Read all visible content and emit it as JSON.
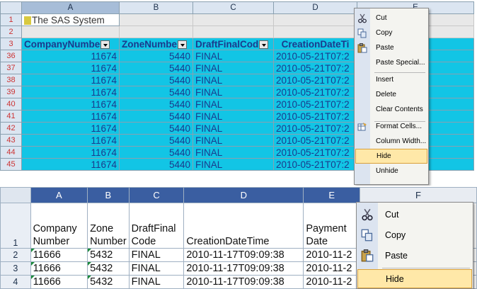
{
  "top_sheet": {
    "columns": [
      "A",
      "B",
      "C",
      "D",
      "E"
    ],
    "title_row": {
      "row": "1",
      "text": "The SAS System"
    },
    "empty_row": "2",
    "header_row": {
      "row": "3",
      "cells": [
        "CompanyNumbe",
        "ZoneNumbe",
        "DraftFinalCod",
        "CreationDateTi"
      ]
    },
    "rows": [
      {
        "row": "36",
        "company": "11674",
        "zone": "5440",
        "draft": "FINAL",
        "created": "2010-05-21T07:2"
      },
      {
        "row": "37",
        "company": "11674",
        "zone": "5440",
        "draft": "FINAL",
        "created": "2010-05-21T07:2"
      },
      {
        "row": "38",
        "company": "11674",
        "zone": "5440",
        "draft": "FINAL",
        "created": "2010-05-21T07:2"
      },
      {
        "row": "39",
        "company": "11674",
        "zone": "5440",
        "draft": "FINAL",
        "created": "2010-05-21T07:2"
      },
      {
        "row": "40",
        "company": "11674",
        "zone": "5440",
        "draft": "FINAL",
        "created": "2010-05-21T07:2"
      },
      {
        "row": "41",
        "company": "11674",
        "zone": "5440",
        "draft": "FINAL",
        "created": "2010-05-21T07:2"
      },
      {
        "row": "42",
        "company": "11674",
        "zone": "5440",
        "draft": "FINAL",
        "created": "2010-05-21T07:2"
      },
      {
        "row": "43",
        "company": "11674",
        "zone": "5440",
        "draft": "FINAL",
        "created": "2010-05-21T07:2"
      },
      {
        "row": "44",
        "company": "11674",
        "zone": "5440",
        "draft": "FINAL",
        "created": "2010-05-21T07:2"
      },
      {
        "row": "45",
        "company": "11674",
        "zone": "5440",
        "draft": "FINAL",
        "created": "2010-05-21T07:2"
      }
    ]
  },
  "top_menu": {
    "items": [
      {
        "label": "Cut",
        "icon": "scissors-icon"
      },
      {
        "label": "Copy",
        "icon": "copy-icon"
      },
      {
        "label": "Paste",
        "icon": "paste-icon"
      },
      {
        "label": "Paste Special...",
        "icon": ""
      },
      {
        "label": "Insert",
        "icon": ""
      },
      {
        "label": "Delete",
        "icon": ""
      },
      {
        "label": "Clear Contents",
        "icon": ""
      },
      {
        "label": "Format Cells...",
        "icon": "format-cells-icon"
      },
      {
        "label": "Column Width...",
        "icon": ""
      },
      {
        "label": "Hide",
        "icon": "",
        "highlighted": true
      },
      {
        "label": "Unhide",
        "icon": ""
      }
    ]
  },
  "bottom_sheet": {
    "columns": [
      "A",
      "B",
      "C",
      "D",
      "E",
      "F"
    ],
    "header_row": {
      "row": "1",
      "cells": [
        "Company Number",
        "Zone Number",
        "DraftFinal Code",
        "CreationDateTime",
        "Payment Date"
      ]
    },
    "rows": [
      {
        "row": "2",
        "company": "11666",
        "zone": "5432",
        "draft": "FINAL",
        "created": "2010-11-17T09:09:38",
        "payment": "2010-11-2"
      },
      {
        "row": "3",
        "company": "11666",
        "zone": "5432",
        "draft": "FINAL",
        "created": "2010-11-17T09:09:38",
        "payment": "2010-11-2"
      },
      {
        "row": "4",
        "company": "11666",
        "zone": "5432",
        "draft": "FINAL",
        "created": "2010-11-17T09:09:38",
        "payment": "2010-11-2"
      }
    ]
  },
  "bottom_menu": {
    "items": [
      {
        "label": "Cut",
        "icon": "scissors-icon"
      },
      {
        "label": "Copy",
        "icon": "copy-icon"
      },
      {
        "label": "Paste",
        "icon": "paste-icon"
      },
      {
        "label": "Hide",
        "icon": "",
        "highlighted": true
      }
    ]
  },
  "colors": {
    "cyan_fill": "#12c5e5",
    "menu_highlight": "#ffe8a8",
    "bottom_col_header": "#3a5ea1"
  }
}
